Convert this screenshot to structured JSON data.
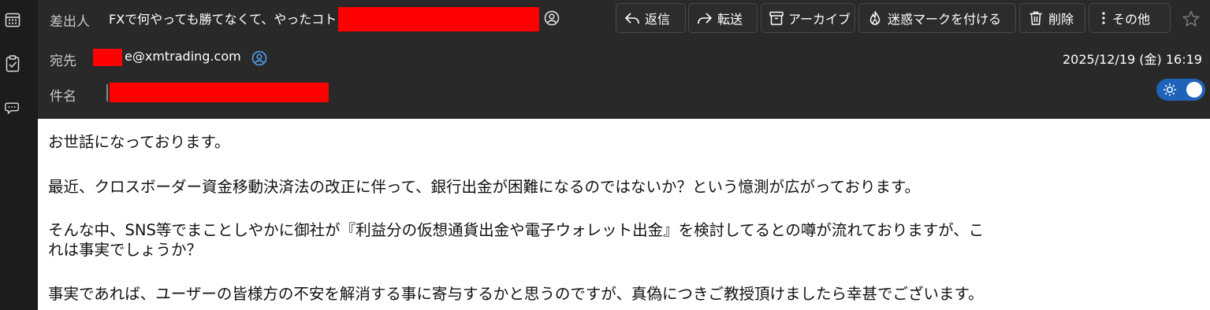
{
  "header": {
    "from_label": "差出人",
    "from_subject": "FXで何やっても勝てなくて、やったコト",
    "to_label": "宛先",
    "to_address": "e@xmtrading.com",
    "subject_label": "件名",
    "date": "2025/12/19 (金) 16:19"
  },
  "toolbar": {
    "reply": "返信",
    "forward": "転送",
    "archive": "アーカイブ",
    "junk": "迷惑マークを付ける",
    "delete": "削除",
    "more": "その他"
  },
  "body": {
    "line1": "お世話になっております。",
    "line2": "最近、クロスボーダー資金移動決済法の改正に伴って、銀行出金が困難になるのではないか？という憶測が広がっております。",
    "line3": "そんな中、SNS等でまことしやかに御社が『利益分の仮想通貨出金や電子ウォレット出金』を検討してるとの噂が流れておりますが、こ",
    "line4": "れは事実でしょうか？",
    "line5": "事実であれば、ユーザーの皆様方の不安を解消する事に寄与するかと思うのですが、真偽につきご教授頂けましたら幸甚でございます。"
  },
  "colors": {
    "accent": "#1e63b8",
    "redaction": "#ff0000"
  }
}
